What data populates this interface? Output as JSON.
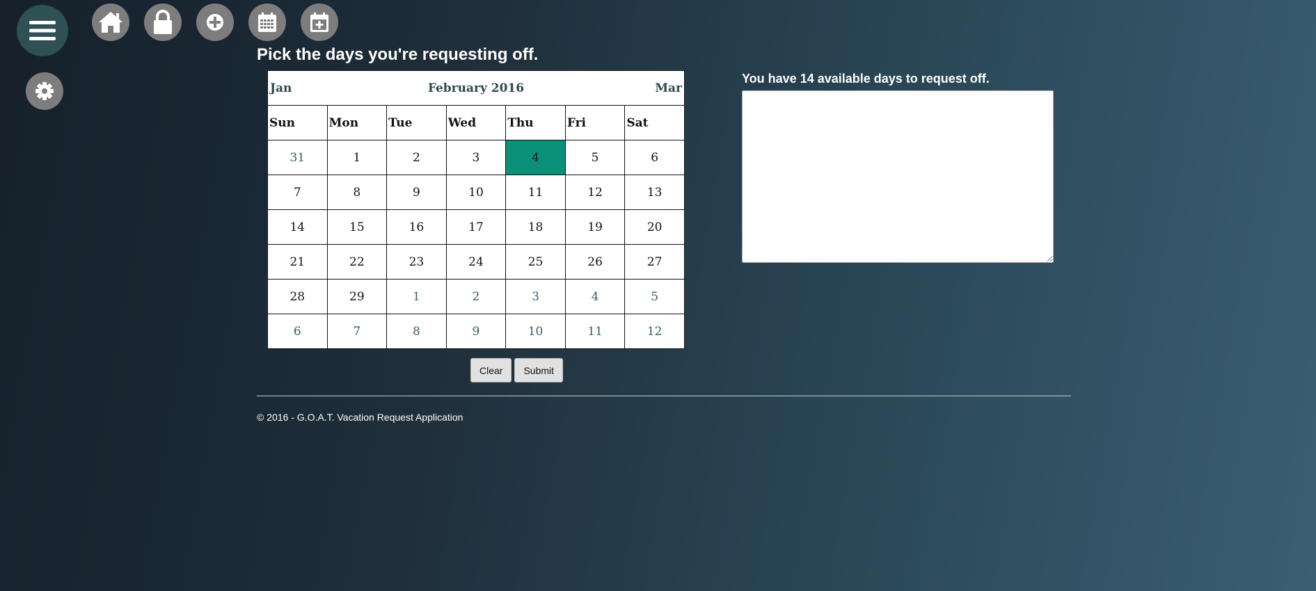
{
  "nav": {
    "menu_icon": "hamburger-menu-icon",
    "settings_icon": "gear-icon",
    "top_icons": [
      "home-icon",
      "lock-icon",
      "plus-circle-icon",
      "calendar-icon",
      "calendar-add-icon"
    ]
  },
  "page": {
    "title": "Pick the days you're requesting off."
  },
  "calendar": {
    "prev_label": "Jan",
    "month_title": "February 2016",
    "next_label": "Mar",
    "weekdays": [
      "Sun",
      "Mon",
      "Tue",
      "Wed",
      "Thu",
      "Fri",
      "Sat"
    ],
    "weeks": [
      [
        {
          "d": "31",
          "other": true
        },
        {
          "d": "1"
        },
        {
          "d": "2"
        },
        {
          "d": "3"
        },
        {
          "d": "4",
          "selected": true
        },
        {
          "d": "5"
        },
        {
          "d": "6"
        }
      ],
      [
        {
          "d": "7"
        },
        {
          "d": "8"
        },
        {
          "d": "9"
        },
        {
          "d": "10"
        },
        {
          "d": "11"
        },
        {
          "d": "12"
        },
        {
          "d": "13"
        }
      ],
      [
        {
          "d": "14"
        },
        {
          "d": "15"
        },
        {
          "d": "16"
        },
        {
          "d": "17"
        },
        {
          "d": "18"
        },
        {
          "d": "19"
        },
        {
          "d": "20"
        }
      ],
      [
        {
          "d": "21"
        },
        {
          "d": "22"
        },
        {
          "d": "23"
        },
        {
          "d": "24"
        },
        {
          "d": "25"
        },
        {
          "d": "26"
        },
        {
          "d": "27"
        }
      ],
      [
        {
          "d": "28"
        },
        {
          "d": "29"
        },
        {
          "d": "1",
          "other": true
        },
        {
          "d": "2",
          "other": true
        },
        {
          "d": "3",
          "other": true
        },
        {
          "d": "4",
          "other": true
        },
        {
          "d": "5",
          "other": true
        }
      ],
      [
        {
          "d": "6",
          "other": true
        },
        {
          "d": "7",
          "other": true
        },
        {
          "d": "8",
          "other": true
        },
        {
          "d": "9",
          "other": true
        },
        {
          "d": "10",
          "other": true
        },
        {
          "d": "11",
          "other": true
        },
        {
          "d": "12",
          "other": true
        }
      ]
    ],
    "selected_color": "#0b917a"
  },
  "actions": {
    "clear_label": "Clear",
    "submit_label": "Submit"
  },
  "request": {
    "available_text": "You have 14 available days to request off.",
    "notes_value": ""
  },
  "footer": {
    "text": "© 2016 - G.O.A.T. Vacation Request Application"
  }
}
